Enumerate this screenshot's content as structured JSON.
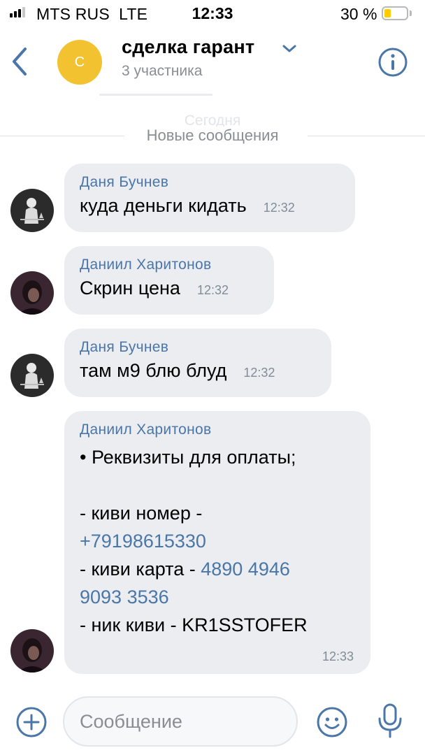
{
  "status_bar": {
    "carrier": "MTS RUS",
    "network": "LTE",
    "time": "12:33",
    "battery_percent": "30 %",
    "battery_level": 0.3,
    "signal_bars_active": 3,
    "signal_bars_total": 4
  },
  "header": {
    "avatar_letter": "С",
    "avatar_color": "#f2c230",
    "title": "сделка гарант",
    "subtitle": "3 участника"
  },
  "date_separator": "Сегодня",
  "new_messages_label": "Новые сообщения",
  "messages": [
    {
      "sender": "Даня Бучнев",
      "text": "куда деньги кидать",
      "time": "12:32"
    },
    {
      "sender": "Даниил Харитонов",
      "text": "Скрин цена",
      "time": "12:32"
    },
    {
      "sender": "Даня Бучнев",
      "text": "там м9 блю блуд",
      "time": "12:32"
    },
    {
      "sender": "Даниил Харитонов",
      "time": "12:33",
      "line1": "• Реквизиты для оплаты;",
      "line2": "- киви номер -",
      "phone": "+79198615330",
      "card_prefix": "- киви карта - ",
      "card_part1": "4890 4946",
      "card_part2": "9093 3536",
      "nick": "- ник киви - KR1SSTOFER"
    }
  ],
  "composer": {
    "placeholder": "Сообщение"
  },
  "colors": {
    "accent": "#4a76a8",
    "bubble": "#ebedf0",
    "battery": "#ffcc00"
  },
  "icons": [
    "back-arrow-icon",
    "chevron-down-icon",
    "info-icon",
    "plus-icon",
    "smile-icon",
    "microphone-icon"
  ]
}
